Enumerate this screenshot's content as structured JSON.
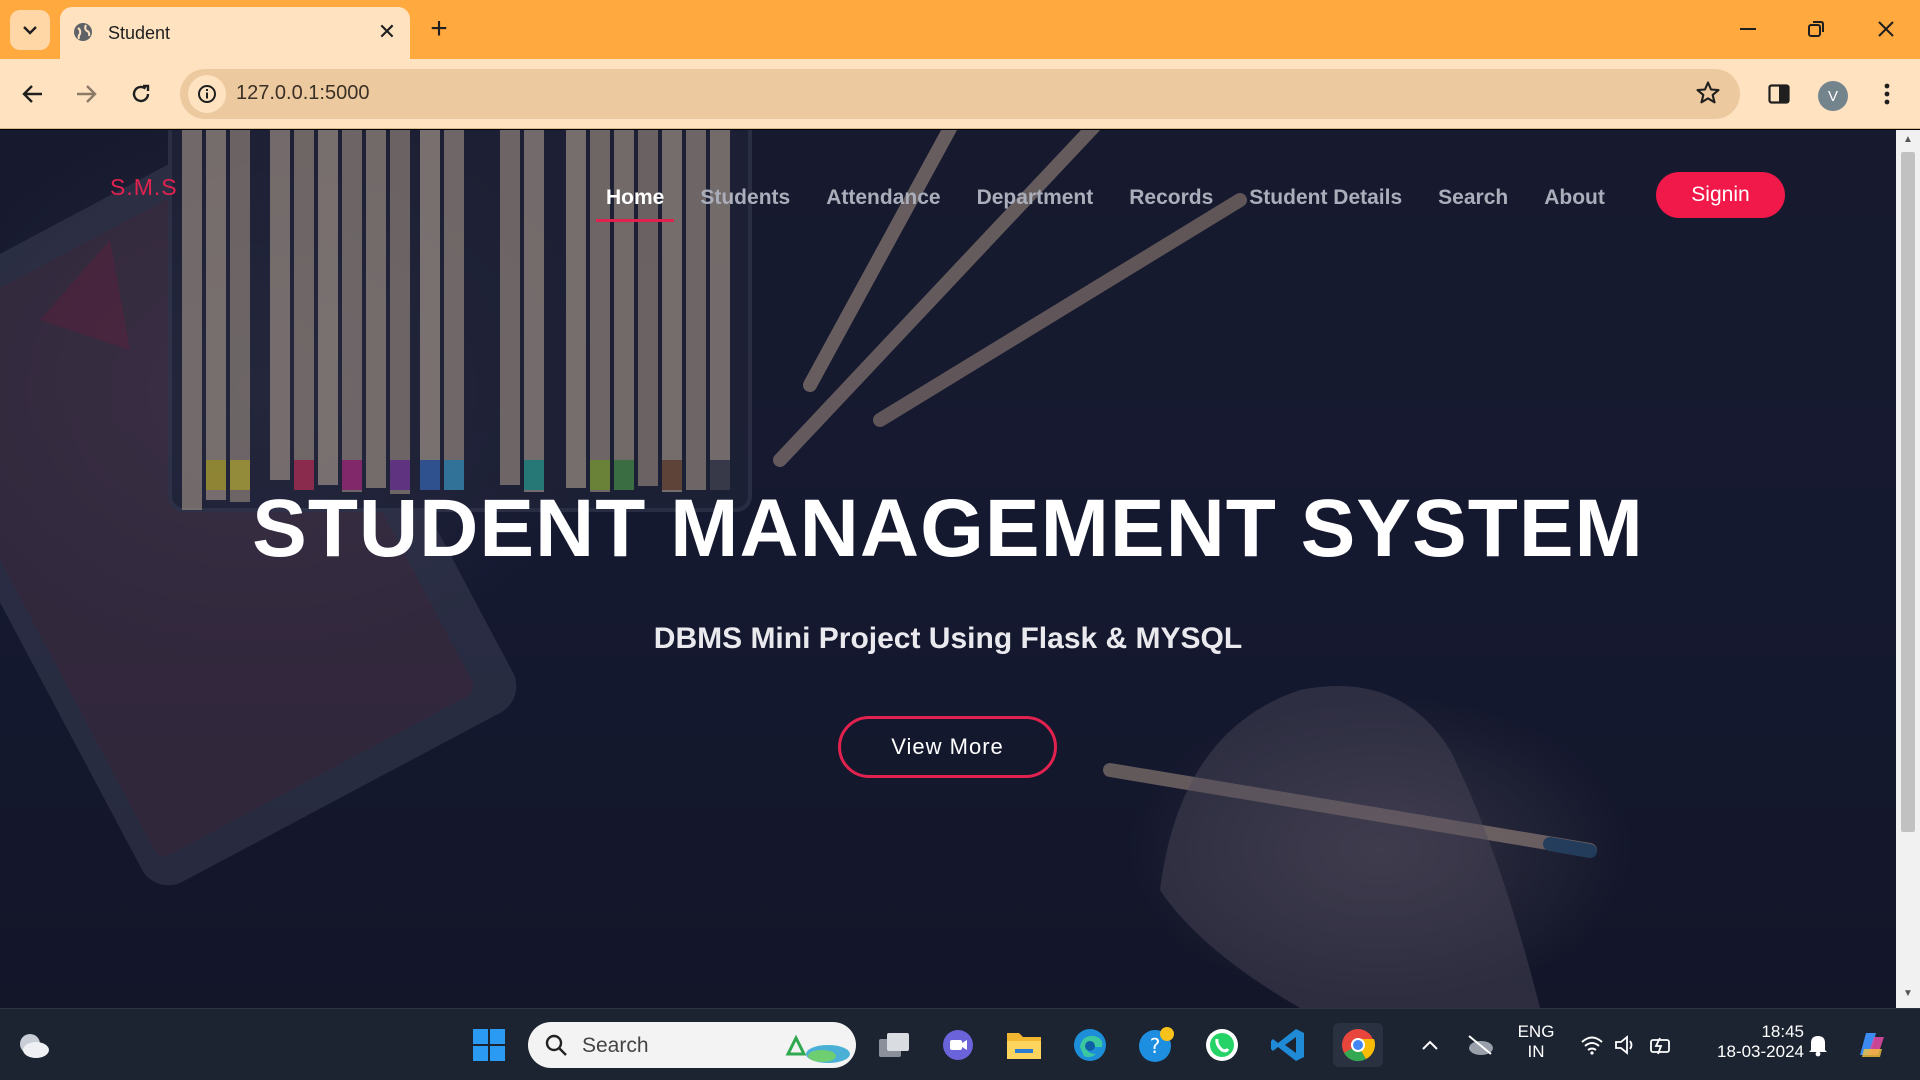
{
  "browser": {
    "tab_title": "Student",
    "url": "127.0.0.1:5000",
    "profile_initial": "V"
  },
  "site": {
    "brand": "S.M.S",
    "nav": [
      "Home",
      "Students",
      "Attendance",
      "Department",
      "Records",
      "Student Details",
      "Search",
      "About"
    ],
    "active_nav": "Home",
    "signin_label": "Signin",
    "hero_title": "STUDENT MANAGEMENT SYSTEM",
    "hero_subtitle": "DBMS Mini Project Using Flask & MYSQL",
    "view_more_label": "View More",
    "accent_color": "#e1224f"
  },
  "taskbar": {
    "search_label": "Search",
    "language_top": "ENG",
    "language_bottom": "IN",
    "time": "18:45",
    "date": "18-03-2024"
  }
}
